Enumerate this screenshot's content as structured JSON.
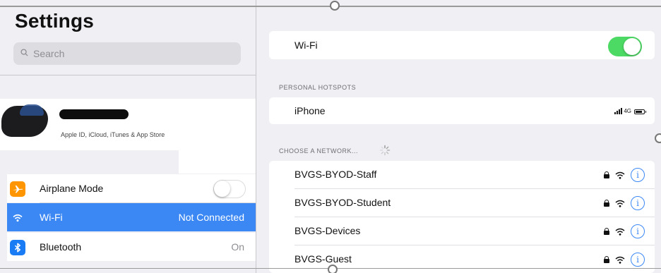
{
  "sidebar": {
    "title": "Settings",
    "search_placeholder": "Search",
    "account": {
      "name": "████████",
      "subtitle": "Apple ID, iCloud, iTunes & App Store"
    },
    "items": [
      {
        "label": "Airplane Mode",
        "icon": "airplane-icon",
        "icon_color": "#ff9500",
        "toggle": false
      },
      {
        "label": "Wi-Fi",
        "icon": "wifi-icon",
        "icon_color": "#3b88f5",
        "value": "Not Connected",
        "selected": true
      },
      {
        "label": "Bluetooth",
        "icon": "bluetooth-icon",
        "icon_color": "#1a7cf5",
        "value": "On"
      }
    ]
  },
  "detail": {
    "wifi_label": "Wi-Fi",
    "wifi_enabled": true,
    "hotspots_header": "PERSONAL HOTSPOTS",
    "hotspot": {
      "name": "iPhone",
      "network": "4G"
    },
    "networks_header": "CHOOSE A NETWORK...",
    "networks": [
      {
        "name": "BVGS-BYOD-Staff",
        "secured": true
      },
      {
        "name": "BVGS-BYOD-Student",
        "secured": true
      },
      {
        "name": "BVGS-Devices",
        "secured": true
      },
      {
        "name": "BVGS-Guest",
        "secured": true
      }
    ],
    "info_glyph": "i"
  },
  "colors": {
    "accent": "#3b88f5",
    "toggle_on": "#4cd964",
    "background": "#efeff4"
  }
}
